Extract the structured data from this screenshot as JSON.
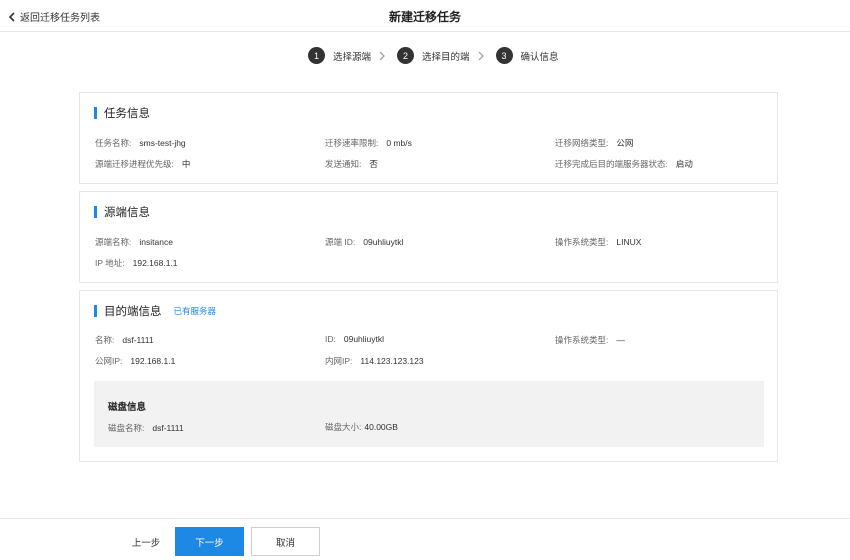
{
  "header": {
    "back_label": "返回迁移任务列表",
    "title": "新建迁移任务"
  },
  "steps": [
    {
      "num": "1",
      "label": "选择源端"
    },
    {
      "num": "2",
      "label": "选择目的端"
    },
    {
      "num": "3",
      "label": "确认信息"
    }
  ],
  "task_info": {
    "title": "任务信息",
    "task_name_label": "任务名称:",
    "task_name": "sms-test-jhg",
    "rate_limit_label": "迁移速率限制:",
    "rate_limit": "0 mb/s",
    "network_type_label": "迁移网络类型:",
    "network_type": "公网",
    "priority_label": "源端迁移进程优先级:",
    "priority": "中",
    "notify_label": "发送通知:",
    "notify": "否",
    "dest_state_label": "迁移完成后目的端服务器状态:",
    "dest_state": "启动"
  },
  "source_info": {
    "title": "源端信息",
    "name_label": "源端名称:",
    "name": "insitance",
    "id_label": "源端 ID:",
    "id": "09uhliuytkl",
    "os_label": "操作系统类型:",
    "os": "LINUX",
    "ip_label": "IP 地址:",
    "ip": "192.168.1.1"
  },
  "dest_info": {
    "title": "目的端信息",
    "tag": "已有服务器",
    "name_label": "名称:",
    "name": "dsf-1111",
    "id_label": "ID:",
    "id": "09uhliuytkl",
    "os_label": "操作系统类型:",
    "os": "—",
    "public_ip_label": "公网IP:",
    "public_ip": "192.168.1.1",
    "private_ip_label": "内网IP:",
    "private_ip": "114.123.123.123",
    "disk": {
      "title": "磁盘信息",
      "name_label": "磁盘名称:",
      "name": "dsf-1111",
      "size_label": "磁盘大小:",
      "size": "40.00GB"
    }
  },
  "footer": {
    "prev_label": "上一步",
    "next_label": "下一步",
    "cancel_label": "取消"
  },
  "colors": {
    "accent": "#1e88e5",
    "step_circle": "#333333"
  }
}
